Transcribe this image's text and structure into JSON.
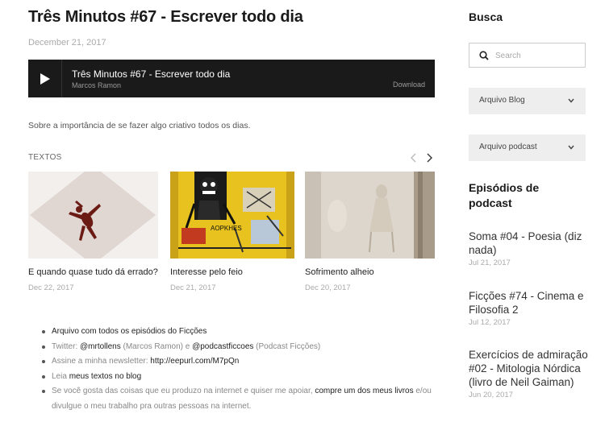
{
  "post": {
    "title": "Três Minutos #67 - Escrever todo dia",
    "date": "December 21, 2017",
    "description": "Sobre a importância de se fazer algo criativo todos os dias."
  },
  "player": {
    "title": "Três Minutos #67 - Escrever todo dia",
    "author": "Marcos Ramon",
    "download_label": "Download",
    "play_icon": "play-icon"
  },
  "textos": {
    "header": "TEXTOS",
    "prev_icon": "chevron-left-icon",
    "next_icon": "chevron-right-icon",
    "cards": [
      {
        "title": "E quando quase tudo dá errado?",
        "date": "Dec 22, 2017"
      },
      {
        "title": "Interesse pelo feio",
        "date": "Dec 21, 2017"
      },
      {
        "title": "Sofrimento alheio",
        "date": "Dec 20, 2017"
      }
    ],
    "painting_text": "AOPKHES"
  },
  "links": [
    {
      "link": "Arquivo com todos os episódios do Ficções"
    },
    {
      "prefix": "Twitter: ",
      "link1": "@mrtollens",
      "mid1": " (Marcos Ramon) e ",
      "link2": "@podcastficcoes",
      "mid2": " (Podcast Ficções)"
    },
    {
      "prefix": "Assine a minha newsletter: ",
      "link": "http://eepurl.com/M7pQn"
    },
    {
      "prefix": "Leia ",
      "link": "meus textos no blog"
    },
    {
      "prefix": "Se você gosta das coisas que eu produzo na internet e quiser me apoiar, ",
      "link": "compre um dos meus livros",
      "suffix": " e/ou divulgue o meu trabalho pra outras pessoas na internet."
    }
  ],
  "sidebar": {
    "search_title": "Busca",
    "search_placeholder": "Search",
    "archive_blog": "Arquivo Blog",
    "archive_podcast": "Arquivo podcast",
    "episodes_heading": "Episódios de podcast",
    "episodes": [
      {
        "title": "Soma #04 - Poesia (diz nada)",
        "date": "Jul 21, 2017"
      },
      {
        "title": "Ficções #74 - Cinema e Filosofia 2",
        "date": "Jul 12, 2017"
      },
      {
        "title": "Exercícios de admiração #02 - Mitologia Nórdica (livro de Neil Gaiman)",
        "date": "Jun 20, 2017"
      }
    ]
  },
  "colors": {
    "player_bg": "#1a1a1a",
    "select_bg": "#eeeeee",
    "muted_text": "#aaaaaa"
  }
}
